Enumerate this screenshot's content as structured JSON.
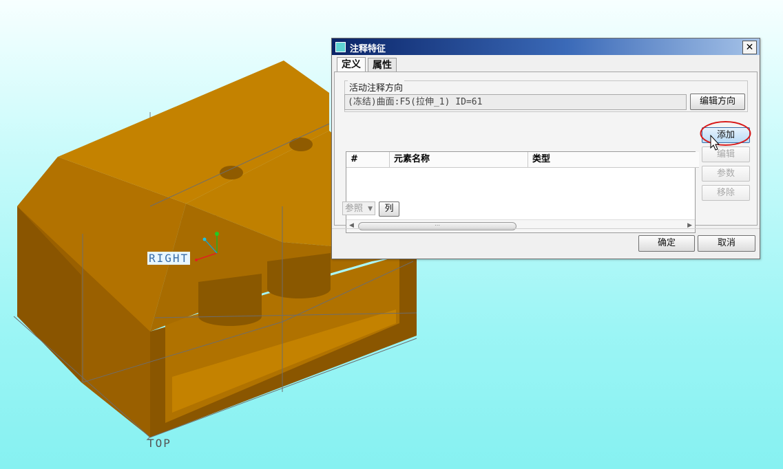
{
  "viewport": {
    "plane_labels": {
      "right": "RIGHT",
      "top": "TOP"
    },
    "model_color": "#c48200",
    "background_color": "#9cf5f5"
  },
  "dialog": {
    "title": "注释特征",
    "close_symbol": "✕",
    "tabs": [
      {
        "label": "定义",
        "active": true
      },
      {
        "label": "属性",
        "active": false
      }
    ],
    "orientation_group": {
      "title": "活动注释方向",
      "reference_value": "(冻结)曲面:F5(拉伸_1) ID=61",
      "edit_button_label": "编辑方向"
    },
    "table": {
      "columns": [
        "#",
        "元素名称",
        "类型"
      ],
      "rows": []
    },
    "side_buttons": [
      {
        "label": "添加",
        "enabled": true
      },
      {
        "label": "编辑",
        "enabled": false
      },
      {
        "label": "参数",
        "enabled": false
      },
      {
        "label": "移除",
        "enabled": false
      }
    ],
    "bottom_controls": {
      "reference_dropdown_label": "参照",
      "columns_button_label": "列"
    },
    "ok_label": "确定",
    "cancel_label": "取消"
  },
  "annotation": {
    "arrow_color": "#e01414",
    "highlight_color": "#d81a1a"
  }
}
